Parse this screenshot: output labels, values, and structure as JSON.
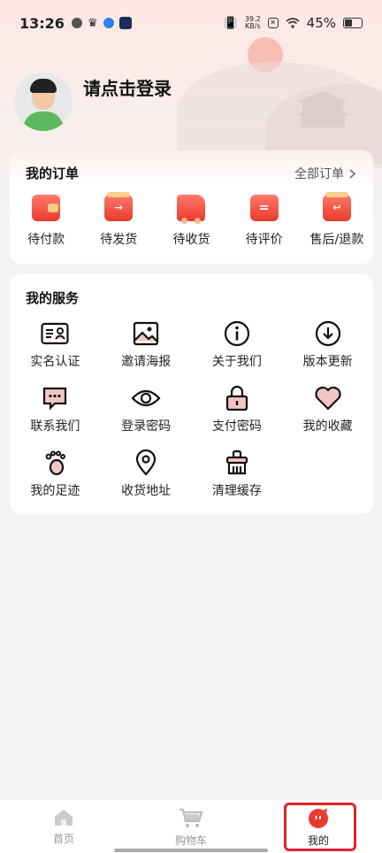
{
  "status_bar": {
    "time": "13:26",
    "net_speed_value": "39.2",
    "net_speed_unit": "KB/s",
    "battery": "45%"
  },
  "profile": {
    "login_prompt": "请点击登录"
  },
  "orders": {
    "title": "我的订单",
    "all_label": "全部订单",
    "items": [
      {
        "label": "待付款",
        "icon": "wallet-icon"
      },
      {
        "label": "待发货",
        "icon": "ship-box-icon"
      },
      {
        "label": "待收货",
        "icon": "truck-icon"
      },
      {
        "label": "待评价",
        "icon": "review-icon"
      },
      {
        "label": "售后/退款",
        "icon": "refund-icon"
      }
    ]
  },
  "services": {
    "title": "我的服务",
    "items": [
      {
        "label": "实名认证",
        "icon": "id-card-icon"
      },
      {
        "label": "邀请海报",
        "icon": "image-icon"
      },
      {
        "label": "关于我们",
        "icon": "info-icon"
      },
      {
        "label": "版本更新",
        "icon": "download-icon"
      },
      {
        "label": "联系我们",
        "icon": "chat-icon"
      },
      {
        "label": "登录密码",
        "icon": "eye-icon"
      },
      {
        "label": "支付密码",
        "icon": "lock-icon"
      },
      {
        "label": "我的收藏",
        "icon": "heart-icon"
      },
      {
        "label": "我的足迹",
        "icon": "footprint-icon"
      },
      {
        "label": "收货地址",
        "icon": "location-icon"
      },
      {
        "label": "清理缓存",
        "icon": "broom-icon"
      }
    ]
  },
  "tabbar": {
    "home": "首页",
    "cart": "购物车",
    "mine": "我的"
  },
  "colors": {
    "accent": "#e83a2d",
    "highlight_box": "#e3222b"
  }
}
